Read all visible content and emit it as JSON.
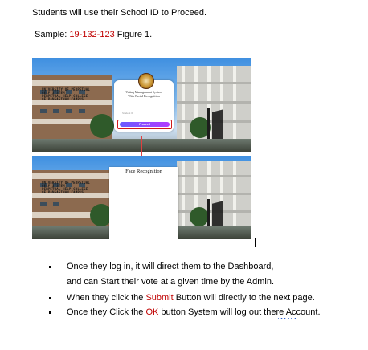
{
  "intro": "Students will use their School ID to Proceed.",
  "sample": {
    "label": "Sample:",
    "id": "19-132-123",
    "figure": "Figure 1."
  },
  "login_card": {
    "title_line1": "Voting Management System",
    "title_line2": "With Facial Recognition",
    "id_placeholder": "Student ID",
    "proceed_label": "Proceed"
  },
  "campus_sign": [
    "UNIVERSITY OF PERPETUAL",
    "HELP SYSTEM",
    "PERPETUAL HELP COLLEGE",
    "OF PANGASINAN CAMPUS"
  ],
  "face_recognition_title": "Face Recognition",
  "bullets": [
    {
      "pre": "Once they log in, it will direct them to the Dashboard,",
      "highlight": "",
      "post": ""
    },
    {
      "pre": "and can Start their vote at a given time by the Admin.",
      "highlight": "",
      "post": ""
    },
    {
      "pre": "When they click the ",
      "highlight": "Submit",
      "post": " Button will directly to the next page."
    },
    {
      "pre": "Once they Click the ",
      "highlight": "OK",
      "post": " button System will log out there Account."
    }
  ],
  "colors": {
    "highlight": "#c00000",
    "button_gradient_start": "#6a5cff",
    "button_gradient_end": "#b23cff"
  }
}
